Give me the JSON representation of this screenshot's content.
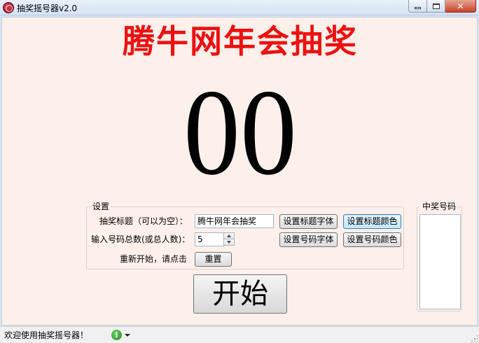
{
  "window": {
    "title": "抽奖摇号器v2.0",
    "icons": {
      "app": "lottery-app-icon",
      "minimize": "minimize-icon",
      "maximize": "maximize-icon",
      "close": "close-icon"
    }
  },
  "main": {
    "display_title": "腾牛网年会抽奖",
    "title_color": "#ee1111",
    "current_number": "00"
  },
  "settings": {
    "group_label": "设置",
    "title_label": "抽奖标题（可以为空）：",
    "title_value": "腾牛网年会抽奖",
    "total_label": "输入号码总数(或总人数)：",
    "total_value": "5",
    "reset_label": "重新开始，请点击",
    "reset_button": "重置",
    "set_title_font": "设置标题字体",
    "set_title_color": "设置标题颜色",
    "set_number_font": "设置号码字体",
    "set_number_color": "设置号码颜色"
  },
  "start_button": "开始",
  "winners": {
    "group_label": "中奖号码",
    "items": []
  },
  "statusbar": {
    "text": "欢迎使用抽奖摇号器！",
    "icon": "info-icon"
  }
}
